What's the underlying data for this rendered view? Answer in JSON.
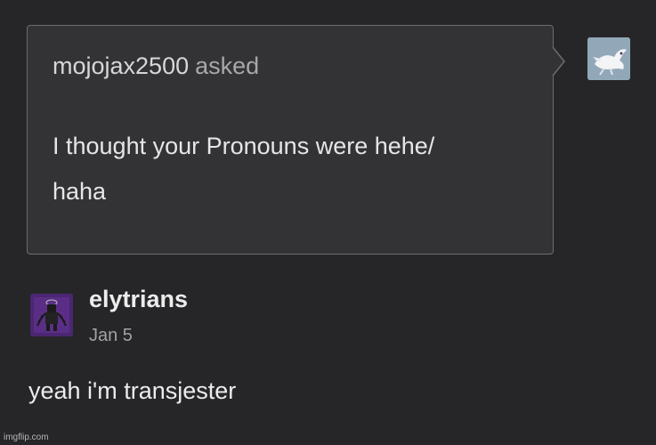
{
  "ask": {
    "asker_name": "mojojax2500",
    "asked_label": "asked",
    "question_line1": "I thought your Pronouns were hehe/",
    "question_line2": "haha"
  },
  "answer": {
    "author": "elytrians",
    "date": "Jan 5",
    "text": "yeah i'm transjester"
  },
  "icons": {
    "asker_avatar": "bird-avatar",
    "answer_avatar": "figure-avatar"
  },
  "colors": {
    "background": "#262629",
    "ask_box": "#333336",
    "border": "#6c6c70"
  },
  "watermark": "imgflip.com"
}
